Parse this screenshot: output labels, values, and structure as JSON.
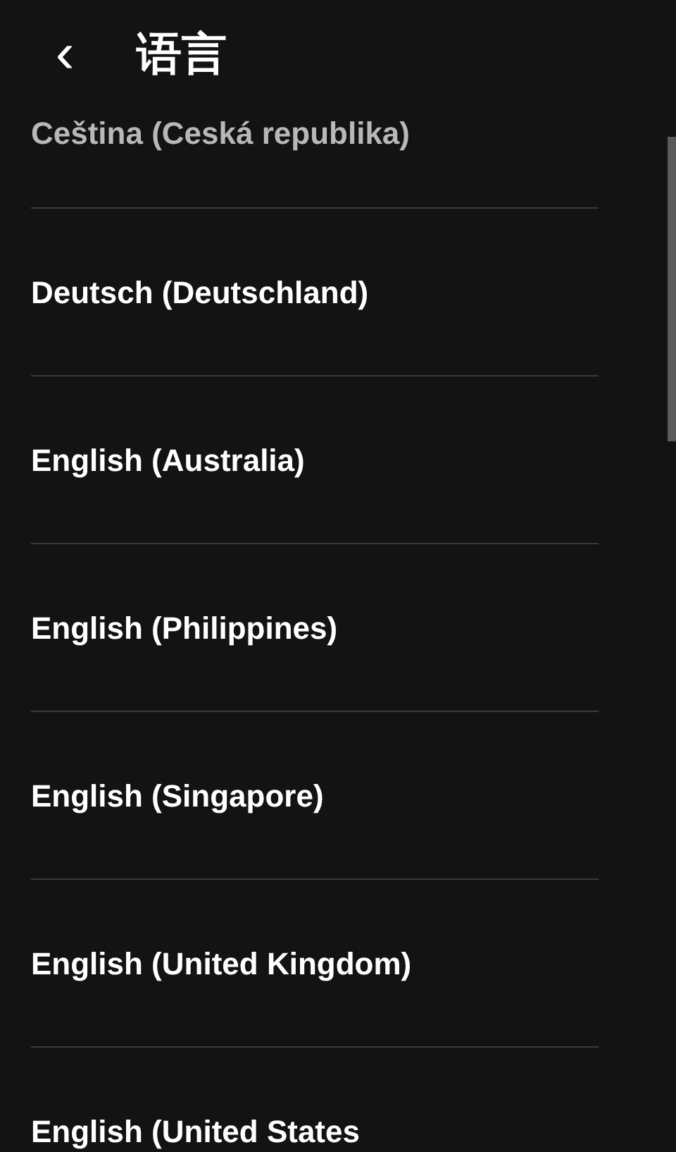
{
  "header": {
    "back": "‹",
    "title": "语言"
  },
  "languages": [
    {
      "label": "Ceština (Ceská republika)",
      "faded": true
    },
    {
      "label": "Deutsch (Deutschland)",
      "faded": false
    },
    {
      "label": "English (Australia)",
      "faded": false
    },
    {
      "label": "English (Philippines)",
      "faded": false
    },
    {
      "label": "English (Singapore)",
      "faded": false
    },
    {
      "label": "English (United Kingdom)",
      "faded": false
    },
    {
      "label": "English (United States",
      "faded": false
    }
  ]
}
